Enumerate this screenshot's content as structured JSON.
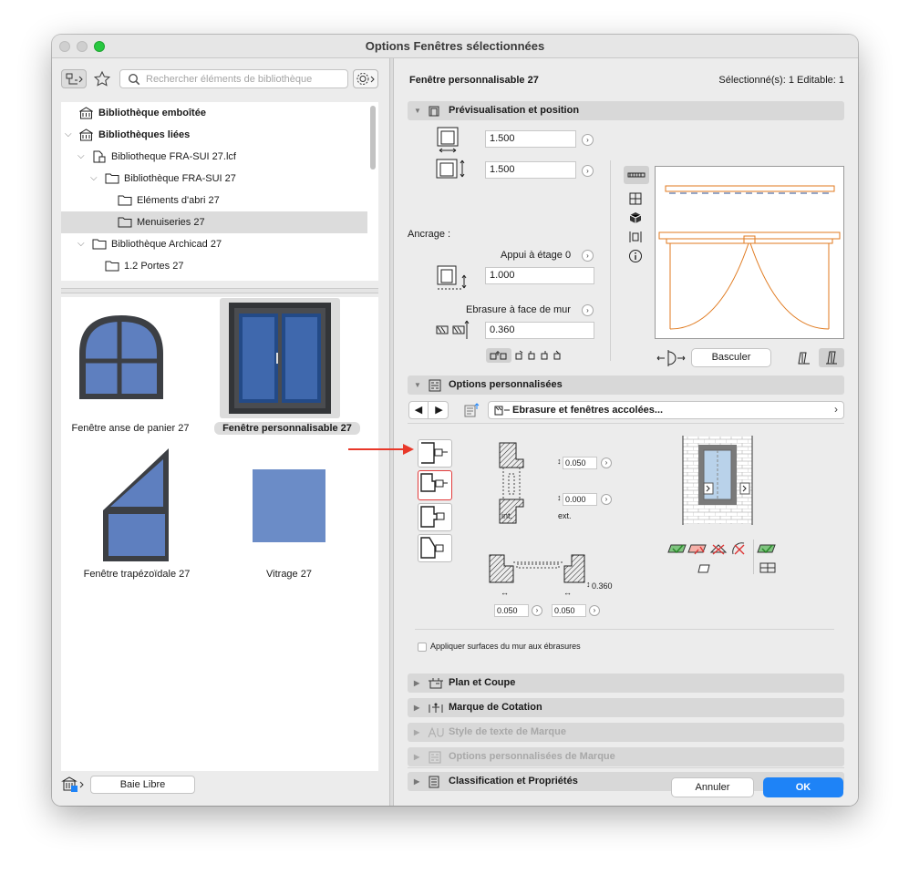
{
  "window": {
    "title": "Options Fenêtres sélectionnées"
  },
  "library": {
    "search_placeholder": "Rechercher éléments de bibliothèque",
    "tree": [
      {
        "label": "Bibliothèque emboîtée"
      },
      {
        "label": "Bibliothèques liées"
      },
      {
        "label": "Bibliotheque FRA-SUI 27.lcf"
      },
      {
        "label": "Bibliothèque FRA-SUI 27"
      },
      {
        "label": "Eléments d'abri 27"
      },
      {
        "label": "Menuiseries 27"
      },
      {
        "label": "Bibliothèque Archicad 27"
      },
      {
        "label": "1.2 Portes 27"
      }
    ],
    "thumbnails": [
      {
        "label": "Fenêtre anse de panier 27"
      },
      {
        "label": "Fenêtre personnalisable 27"
      },
      {
        "label": "Fenêtre trapézoïdale 27"
      },
      {
        "label": "Vitrage 27"
      }
    ],
    "footer_button": "Baie Libre"
  },
  "header": {
    "element_name": "Fenêtre personnalisable 27",
    "selection_info": "Sélectionné(s): 1 Editable: 1"
  },
  "preview": {
    "section_title": "Prévisualisation et position",
    "width_value": "1.500",
    "height_value": "1.500",
    "anchor_label": "Ancrage :",
    "story_label": "Appui à étage 0",
    "sill_value": "1.000",
    "reveal_label": "Ebrasure à face de mur",
    "reveal_value": "0.360",
    "flip_button": "Basculer"
  },
  "custom": {
    "section_title": "Options personnalisées",
    "page_selector": "Ebrasure et fenêtres accolées...",
    "top_reveal": "0.050",
    "bottom_reveal": "0.000",
    "int_label": "int.",
    "ext_label": "ext.",
    "depth_value": "0.360",
    "left_width": "0.050",
    "right_width": "0.050",
    "checkbox_label": "Appliquer surfaces du mur aux ébrasures"
  },
  "sections": [
    {
      "label": "Plan et Coupe",
      "enabled": true
    },
    {
      "label": "Marque de Cotation",
      "enabled": true
    },
    {
      "label": "Style de texte de Marque",
      "enabled": false
    },
    {
      "label": "Options personnalisées de Marque",
      "enabled": false
    },
    {
      "label": "Classification et Propriétés",
      "enabled": true
    }
  ],
  "footer": {
    "cancel": "Annuler",
    "ok": "OK"
  },
  "colors": {
    "accent": "#1e83f7",
    "plan_line": "#e07a1f",
    "glass": "#5e7fbf",
    "annotation_arrow": "#e8382a"
  }
}
